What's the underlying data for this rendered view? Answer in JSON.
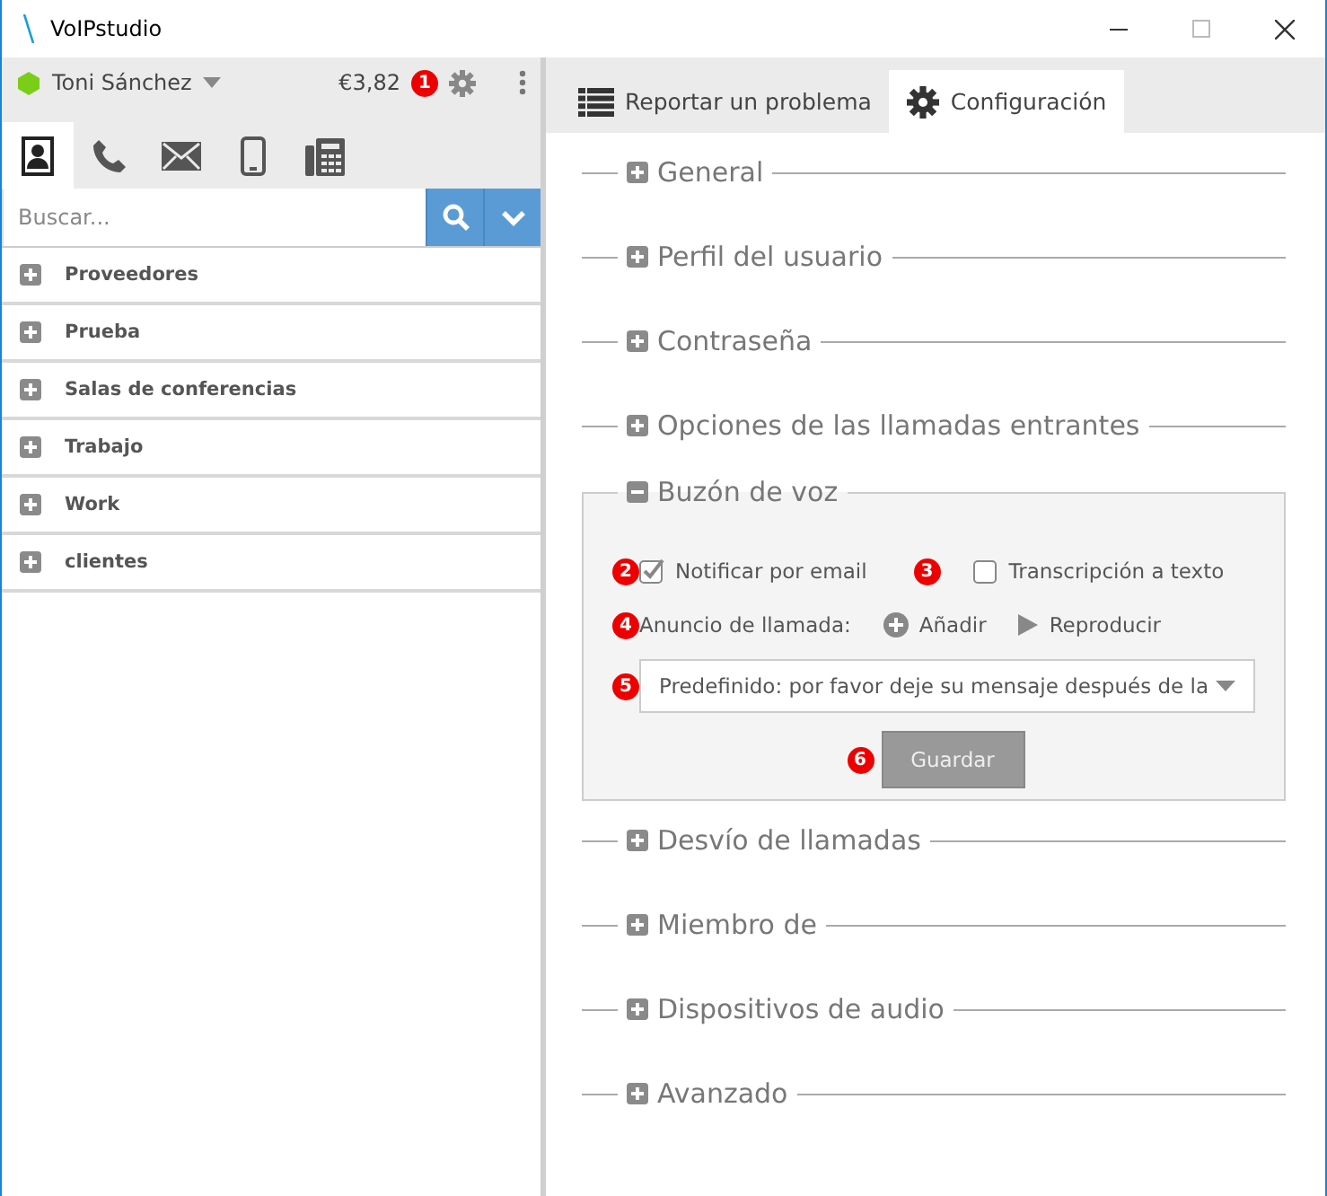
{
  "window": {
    "title": "VoIPstudio"
  },
  "user": {
    "name": "Toni Sánchez",
    "balance": "€3,82",
    "callout": "1"
  },
  "channel_tabs": [
    {
      "kind": "contacts",
      "selected": true
    },
    {
      "kind": "phone",
      "selected": false
    },
    {
      "kind": "mail",
      "selected": false
    },
    {
      "kind": "mobile",
      "selected": false
    },
    {
      "kind": "fax",
      "selected": false
    }
  ],
  "search": {
    "placeholder": "Buscar..."
  },
  "groups": [
    "Proveedores",
    "Prueba",
    "Salas de conferencias",
    "Trabajo",
    "Work",
    "clientes"
  ],
  "tabs": [
    {
      "label": "Reportar un problema",
      "kind": "list",
      "selected": false
    },
    {
      "label": "Configuración",
      "kind": "gear",
      "selected": true
    }
  ],
  "sections": [
    {
      "title": "General",
      "expanded": false
    },
    {
      "title": "Perfil del usuario",
      "expanded": false
    },
    {
      "title": "Contraseña",
      "expanded": false
    },
    {
      "title": "Opciones de las llamadas entrantes",
      "expanded": false
    },
    {
      "title": "Buzón de voz",
      "expanded": true,
      "voicemail": {
        "checkboxes": [
          {
            "callout": "2",
            "label": "Notificar por email",
            "checked": true
          },
          {
            "callout": "3",
            "label": "Transcripción a texto",
            "checked": false
          }
        ],
        "announcement": {
          "callout": "4",
          "label": "Anuncio de llamada:",
          "add": "Añadir",
          "play": "Reproducir"
        },
        "select": {
          "callout": "5",
          "value": "Predefinido: por favor deje su mensaje después de la"
        },
        "save": {
          "callout": "6",
          "label": "Guardar"
        }
      }
    },
    {
      "title": "Desvío de llamadas",
      "expanded": false
    },
    {
      "title": "Miembro de",
      "expanded": false
    },
    {
      "title": "Dispositivos de audio",
      "expanded": false
    },
    {
      "title": "Avanzado",
      "expanded": false
    }
  ]
}
